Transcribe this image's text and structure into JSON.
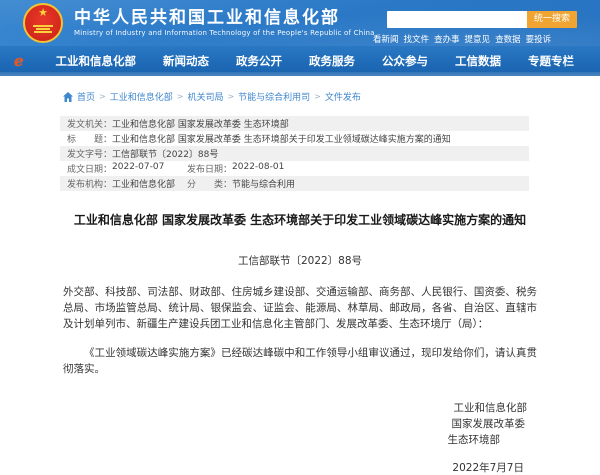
{
  "header": {
    "site_title": "中华人民共和国工业和信息化部",
    "site_subtitle": "Ministry of Industry and Information Technology of the People's Republic of China",
    "emblem_icon": "china-national-emblem",
    "search": {
      "button_label": "统一搜索"
    },
    "quick_links": [
      "看新闻",
      "找文件",
      "查办事",
      "提意见",
      "查数据",
      "要投诉"
    ],
    "colors": {
      "banner_blue": "#2b7ac8",
      "nav_blue": "#1f6bb8",
      "search_button_orange": "#f0a432"
    }
  },
  "nav": {
    "logo": "miit-e-logo",
    "items": [
      "工业和信息化部",
      "新闻动态",
      "政务公开",
      "政务服务",
      "公众参与",
      "工信数据",
      "专题专栏"
    ]
  },
  "breadcrumb": {
    "separator": ">",
    "items": [
      "首页",
      "工业和信息化部",
      "机关司局",
      "节能与综合利用司",
      "文件发布"
    ]
  },
  "meta_table": {
    "rows": [
      {
        "cells": [
          {
            "label": "发文机关：",
            "value": "工业和信息化部 国家发展改革委 生态环境部"
          }
        ]
      },
      {
        "cells": [
          {
            "label": "标　　题：",
            "value": "工业和信息化部 国家发展改革委 生态环境部关于印发工业领域碳达峰实施方案的通知"
          }
        ]
      },
      {
        "cells": [
          {
            "label": "发文字号：",
            "value": "工信部联节〔2022〕88号"
          }
        ]
      },
      {
        "cells": [
          {
            "label": "成文日期：",
            "value": "2022-07-07"
          },
          {
            "label": "发布日期：",
            "value": "2022-08-01"
          }
        ]
      },
      {
        "cells": [
          {
            "label": "发布机构：",
            "value": "工业和信息化部"
          },
          {
            "label": "分　　类：",
            "value": "节能与综合利用"
          }
        ]
      }
    ]
  },
  "document": {
    "title": "工业和信息化部 国家发展改革委 生态环境部关于印发工业领域碳达峰实施方案的通知",
    "doc_number": "工信部联节〔2022〕88号",
    "paragraph_addressees": "外交部、科技部、司法部、财政部、住房城乡建设部、交通运输部、商务部、人民银行、国资委、税务总局、市场监管总局、统计局、银保监会、证监会、能源局、林草局、邮政局，各省、自治区、直辖市及计划单列市、新疆生产建设兵团工业和信息化主管部门、发展改革委、生态环境厅（局）：",
    "paragraph_body": "《工业领域碳达峰实施方案》已经碳达峰碳中和工作领导小组审议通过，现印发给你们，请认真贯彻落实。",
    "signatories": [
      "工业和信息化部",
      "国家发展改革委",
      "生态环境部"
    ],
    "date": "2022年7月7日"
  }
}
